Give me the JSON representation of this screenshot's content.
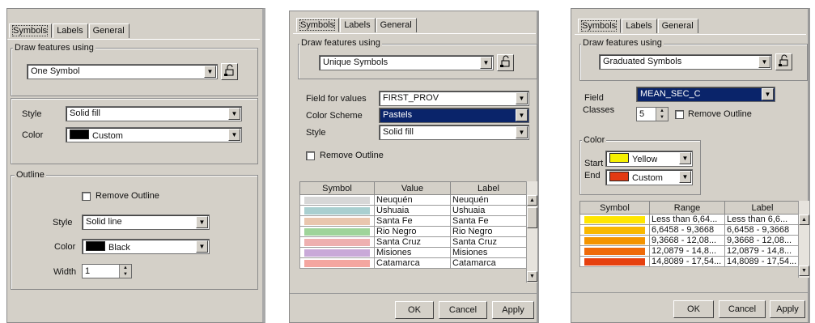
{
  "panel1": {
    "tabs": [
      "Symbols",
      "Labels",
      "General"
    ],
    "draw_legend": "Draw features using",
    "draw_value": "One Symbol",
    "style_label": "Style",
    "style_value": "Solid fill",
    "color_label": "Color",
    "color_value": "Custom",
    "outline_legend": "Outline",
    "remove_outline": "Remove Outline",
    "ostyle_label": "Style",
    "ostyle_value": "Solid line",
    "ocolor_label": "Color",
    "ocolor_value": "Black",
    "width_label": "Width",
    "width_value": "1"
  },
  "panel2": {
    "tabs": [
      "Symbols",
      "Labels",
      "General"
    ],
    "draw_legend": "Draw features using",
    "draw_value": "Unique Symbols",
    "field_label": "Field for values",
    "field_value": "FIRST_PROV",
    "scheme_label": "Color Scheme",
    "scheme_value": "Pastels",
    "style_label": "Style",
    "style_value": "Solid fill",
    "remove_outline": "Remove Outline",
    "columns": [
      "Symbol",
      "Value",
      "Label"
    ],
    "rows": [
      {
        "color": "#d7d7d7",
        "value": "Neuquén",
        "label": "Neuquén"
      },
      {
        "color": "#a9cfd0",
        "value": "Ushuaia",
        "label": "Ushuaia"
      },
      {
        "color": "#e9c6ae",
        "value": "Santa Fe",
        "label": "Santa Fe"
      },
      {
        "color": "#9fd49a",
        "value": "Rio Negro",
        "label": "Rio Negro"
      },
      {
        "color": "#eeb0b0",
        "value": "Santa Cruz",
        "label": "Santa Cruz"
      },
      {
        "color": "#c9a9d8",
        "value": "Misiones",
        "label": "Misiones"
      },
      {
        "color": "#f4a6a0",
        "value": "Catamarca",
        "label": "Catamarca"
      }
    ],
    "ok": "OK",
    "cancel": "Cancel",
    "apply": "Apply"
  },
  "panel3": {
    "tabs": [
      "Symbols",
      "Labels",
      "General"
    ],
    "draw_legend": "Draw features using",
    "draw_value": "Graduated Symbols",
    "field_label": "Field",
    "field_value": "MEAN_SEC_C",
    "classes_label": "Classes",
    "classes_value": "5",
    "remove_outline": "Remove Outline",
    "color_legend": "Color",
    "start_label": "Start",
    "start_value": "Yellow",
    "start_color": "#f6f000",
    "end_label": "End",
    "end_value": "Custom",
    "end_color": "#e23a12",
    "columns": [
      "Symbol",
      "Range",
      "Label"
    ],
    "rows": [
      {
        "color": "#ffe600",
        "range": "Less than 6,64...",
        "label": "Less than 6,6..."
      },
      {
        "color": "#f9b800",
        "range": "6,6458 - 9,3668",
        "label": "6,6458 - 9,3668"
      },
      {
        "color": "#f49400",
        "range": "9,3668 - 12,08...",
        "label": "9,3668 - 12,08..."
      },
      {
        "color": "#ef6a0a",
        "range": "12,0879 - 14,8...",
        "label": "12,0879 - 14,8..."
      },
      {
        "color": "#e6400f",
        "range": "14,8089 - 17,54...",
        "label": "14,8089 - 17,54..."
      }
    ],
    "ok": "OK",
    "cancel": "Cancel",
    "apply": "Apply"
  }
}
